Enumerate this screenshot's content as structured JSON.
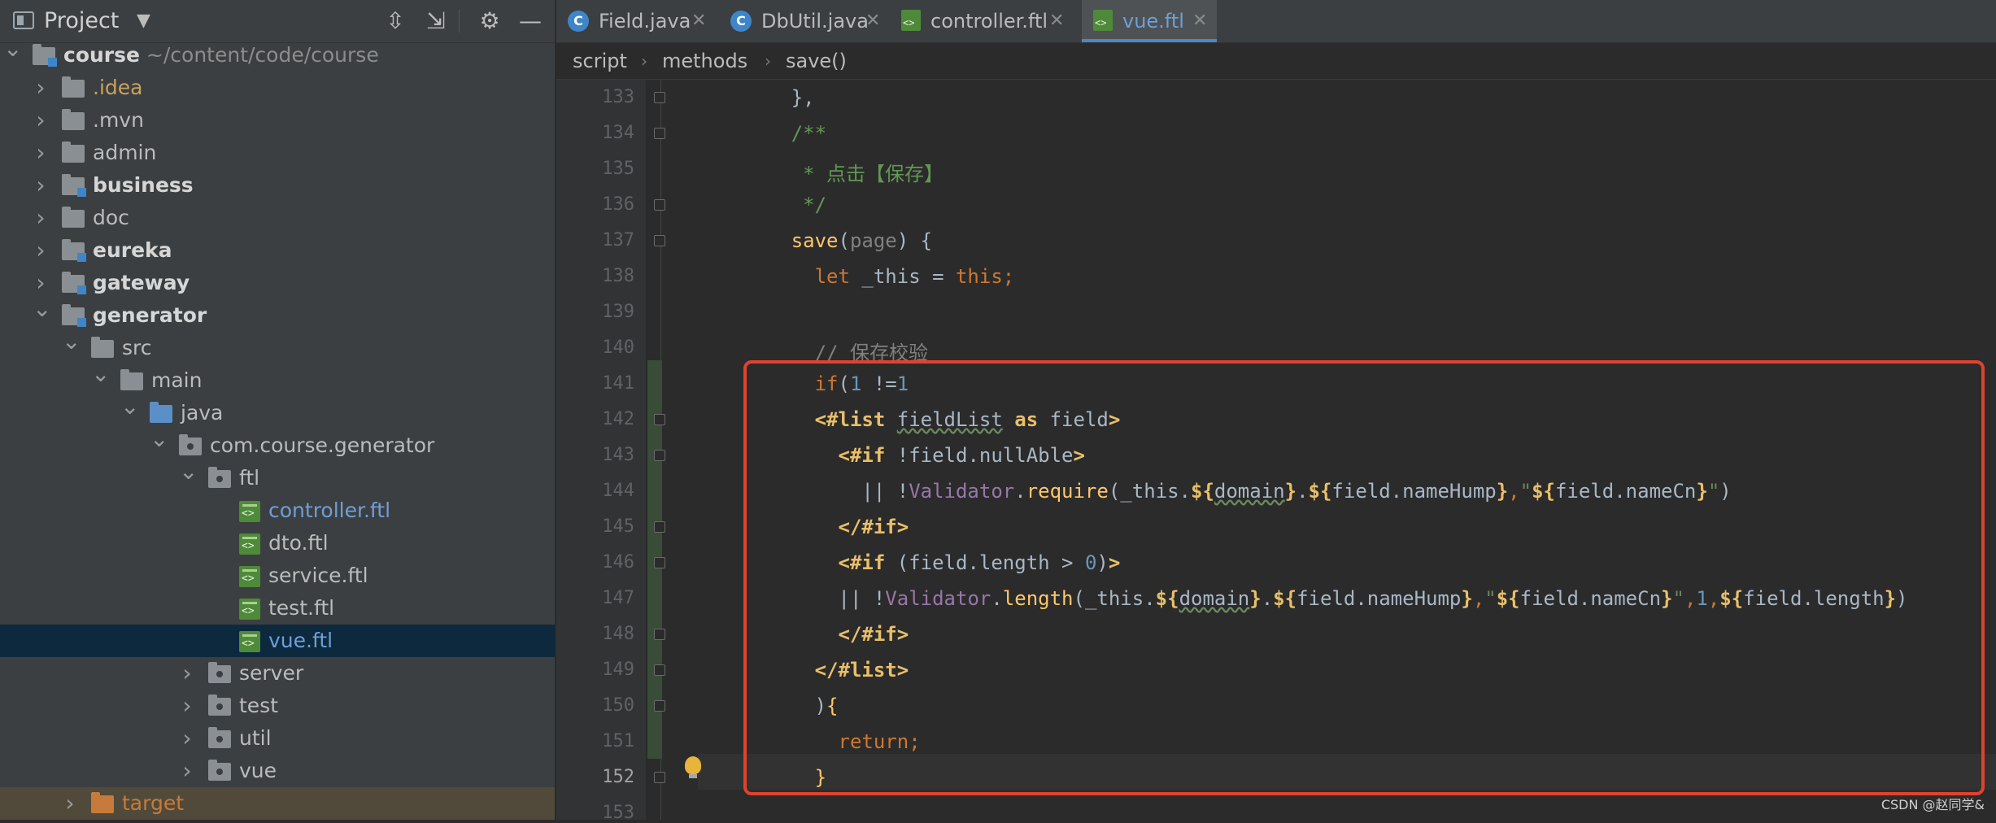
{
  "project_panel": {
    "title": "Project",
    "tree": [
      {
        "label": "course",
        "extra": "~/content/code/course",
        "depth": 0,
        "expanded": true,
        "kind": "module-folder",
        "bold": true
      },
      {
        "label": ".idea",
        "depth": 1,
        "expanded": false,
        "kind": "folder",
        "color": "idea"
      },
      {
        "label": ".mvn",
        "depth": 1,
        "expanded": false,
        "kind": "folder"
      },
      {
        "label": "admin",
        "depth": 1,
        "expanded": false,
        "kind": "folder"
      },
      {
        "label": "business",
        "depth": 1,
        "expanded": false,
        "kind": "module-folder",
        "bold": true
      },
      {
        "label": "doc",
        "depth": 1,
        "expanded": false,
        "kind": "folder"
      },
      {
        "label": "eureka",
        "depth": 1,
        "expanded": false,
        "kind": "module-folder",
        "bold": true
      },
      {
        "label": "gateway",
        "depth": 1,
        "expanded": false,
        "kind": "module-folder",
        "bold": true
      },
      {
        "label": "generator",
        "depth": 1,
        "expanded": true,
        "kind": "module-folder",
        "bold": true
      },
      {
        "label": "src",
        "depth": 2,
        "expanded": true,
        "kind": "folder"
      },
      {
        "label": "main",
        "depth": 3,
        "expanded": true,
        "kind": "folder"
      },
      {
        "label": "java",
        "depth": 4,
        "expanded": true,
        "kind": "source-folder"
      },
      {
        "label": "com.course.generator",
        "depth": 5,
        "expanded": true,
        "kind": "package"
      },
      {
        "label": "ftl",
        "depth": 6,
        "expanded": true,
        "kind": "package"
      },
      {
        "label": "controller.ftl",
        "depth": 7,
        "kind": "ftl-file",
        "color": "blue"
      },
      {
        "label": "dto.ftl",
        "depth": 7,
        "kind": "ftl-file"
      },
      {
        "label": "service.ftl",
        "depth": 7,
        "kind": "ftl-file"
      },
      {
        "label": "test.ftl",
        "depth": 7,
        "kind": "ftl-file"
      },
      {
        "label": "vue.ftl",
        "depth": 7,
        "kind": "ftl-file",
        "selected": true,
        "color": "blue"
      },
      {
        "label": "server",
        "depth": 6,
        "expanded": false,
        "kind": "package"
      },
      {
        "label": "test",
        "depth": 6,
        "expanded": false,
        "kind": "package"
      },
      {
        "label": "util",
        "depth": 6,
        "expanded": false,
        "kind": "package"
      },
      {
        "label": "vue",
        "depth": 6,
        "expanded": false,
        "kind": "package"
      },
      {
        "label": "target",
        "depth": 2,
        "expanded": false,
        "kind": "excluded-folder",
        "color": "orange"
      }
    ]
  },
  "tabs": [
    {
      "label": "Field.java",
      "icon": "java-class-icon",
      "active": false
    },
    {
      "label": "DbUtil.java",
      "icon": "java-class-icon",
      "active": false
    },
    {
      "label": "controller.ftl",
      "icon": "ftl-file-icon",
      "active": false
    },
    {
      "label": "vue.ftl",
      "icon": "ftl-file-icon",
      "active": true
    }
  ],
  "breadcrumb": [
    "script",
    "methods",
    "save()"
  ],
  "editor": {
    "current_line": 152,
    "lines": [
      {
        "n": "133",
        "indent": 6,
        "tokens": [
          [
            "p",
            "},"
          ]
        ]
      },
      {
        "n": "134",
        "indent": 6,
        "tokens": [
          [
            "cm",
            "/**"
          ]
        ]
      },
      {
        "n": "135",
        "indent": 7,
        "tokens": [
          [
            "cm",
            "* 点击【保存】"
          ]
        ]
      },
      {
        "n": "136",
        "indent": 7,
        "tokens": [
          [
            "cm",
            "*/"
          ]
        ]
      },
      {
        "n": "137",
        "indent": 6,
        "tokens": [
          [
            "fn",
            "save"
          ],
          [
            "p",
            "("
          ],
          [
            "gr",
            "page"
          ],
          [
            "p",
            ") {"
          ]
        ]
      },
      {
        "n": "138",
        "indent": 8,
        "tokens": [
          [
            "kw",
            "let "
          ],
          [
            "p",
            "_this = "
          ],
          [
            "kw",
            "this;"
          ]
        ]
      },
      {
        "n": "139",
        "indent": 0,
        "tokens": []
      },
      {
        "n": "140",
        "indent": 8,
        "tokens": [
          [
            "cmg",
            "// 保存校验"
          ]
        ]
      },
      {
        "n": "141",
        "indent": 8,
        "tokens": [
          [
            "kw",
            "if"
          ],
          [
            "p",
            "("
          ],
          [
            "num",
            "1"
          ],
          [
            "p",
            " !="
          ],
          [
            "num",
            "1"
          ]
        ]
      },
      {
        "n": "142",
        "indent": 8,
        "tokens": [
          [
            "ftlk",
            "<#list "
          ],
          [
            "wv",
            "fieldList"
          ],
          [
            "p",
            " "
          ],
          [
            "ftlk",
            "as "
          ],
          [
            "p",
            "field"
          ],
          [
            "ftlk",
            ">"
          ]
        ]
      },
      {
        "n": "143",
        "indent": 10,
        "tokens": [
          [
            "ftlk",
            "<#if "
          ],
          [
            "p",
            "!field.nullAble"
          ],
          [
            "ftlk",
            ">"
          ]
        ]
      },
      {
        "n": "144",
        "indent": 12,
        "tokens": [
          [
            "p",
            "|| !"
          ],
          [
            "pu",
            "Validator"
          ],
          [
            "p",
            "."
          ],
          [
            "fn",
            "require"
          ],
          [
            "p",
            "(_this."
          ],
          [
            "ftlk",
            "${"
          ],
          [
            "wv",
            "domain"
          ],
          [
            "ftlk",
            "}"
          ],
          [
            "p",
            "."
          ],
          [
            "ftlk",
            "${"
          ],
          [
            "p",
            "field.nameHump"
          ],
          [
            "ftlk",
            "}"
          ],
          [
            "kw",
            ","
          ],
          [
            "str",
            "\""
          ],
          [
            "ftlk",
            "${"
          ],
          [
            "p",
            "field.nameCn"
          ],
          [
            "ftlk",
            "}"
          ],
          [
            "str",
            "\""
          ],
          [
            "p",
            ")"
          ]
        ]
      },
      {
        "n": "145",
        "indent": 10,
        "tokens": [
          [
            "ftlk",
            "</#if>"
          ]
        ]
      },
      {
        "n": "146",
        "indent": 10,
        "tokens": [
          [
            "ftlk",
            "<#if "
          ],
          [
            "p",
            "(field.length > "
          ],
          [
            "num",
            "0"
          ],
          [
            "p",
            ")"
          ],
          [
            "ftlk",
            ">"
          ]
        ]
      },
      {
        "n": "147",
        "indent": 10,
        "tokens": [
          [
            "p",
            "|| !"
          ],
          [
            "pu",
            "Validator"
          ],
          [
            "p",
            "."
          ],
          [
            "fn",
            "length"
          ],
          [
            "p",
            "(_this."
          ],
          [
            "ftlk",
            "${"
          ],
          [
            "wv",
            "domain"
          ],
          [
            "ftlk",
            "}"
          ],
          [
            "p",
            "."
          ],
          [
            "ftlk",
            "${"
          ],
          [
            "p",
            "field.nameHump"
          ],
          [
            "ftlk",
            "}"
          ],
          [
            "kw",
            ","
          ],
          [
            "str",
            "\""
          ],
          [
            "ftlk",
            "${"
          ],
          [
            "p",
            "field.nameCn"
          ],
          [
            "ftlk",
            "}"
          ],
          [
            "str",
            "\""
          ],
          [
            "kw",
            ","
          ],
          [
            "num",
            "1"
          ],
          [
            "kw",
            ","
          ],
          [
            "ftlk",
            "${"
          ],
          [
            "p",
            "field.length"
          ],
          [
            "ftlk",
            "}"
          ],
          [
            "p",
            ")"
          ]
        ]
      },
      {
        "n": "148",
        "indent": 10,
        "tokens": [
          [
            "ftlk",
            "</#if>"
          ]
        ]
      },
      {
        "n": "149",
        "indent": 8,
        "tokens": [
          [
            "ftlk",
            "</#list>"
          ]
        ]
      },
      {
        "n": "150",
        "indent": 8,
        "tokens": [
          [
            "p",
            ")"
          ],
          [
            "fn",
            "{"
          ]
        ]
      },
      {
        "n": "151",
        "indent": 10,
        "tokens": [
          [
            "kw",
            "return;"
          ]
        ]
      },
      {
        "n": "152",
        "indent": 8,
        "tokens": [
          [
            "fn",
            "}"
          ]
        ]
      },
      {
        "n": "153",
        "indent": 0,
        "tokens": []
      }
    ]
  },
  "watermark": "CSDN @赵同学&",
  "colors": {
    "highlight_box": "#e0422f",
    "accent": "#4a88c7"
  }
}
